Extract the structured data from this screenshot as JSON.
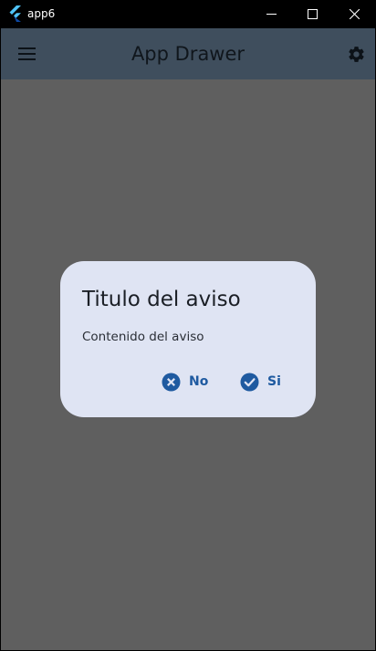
{
  "window": {
    "title": "app6",
    "controls": [
      "minimize",
      "maximize",
      "close"
    ]
  },
  "appbar": {
    "title": "App Drawer",
    "left_icon": "menu-icon",
    "right_icon": "gear-icon"
  },
  "dialog": {
    "title": "Titulo del aviso",
    "content": "Contenido del aviso",
    "actions": [
      {
        "label": "No",
        "icon": "cancel-circle-icon"
      },
      {
        "label": "Si",
        "icon": "check-circle-icon"
      }
    ]
  },
  "colors": {
    "scrim": "#5f5f5f",
    "appbar": "#3f4e5d",
    "dialog_bg": "#dfe4f3",
    "accent": "#1f5aa0"
  }
}
